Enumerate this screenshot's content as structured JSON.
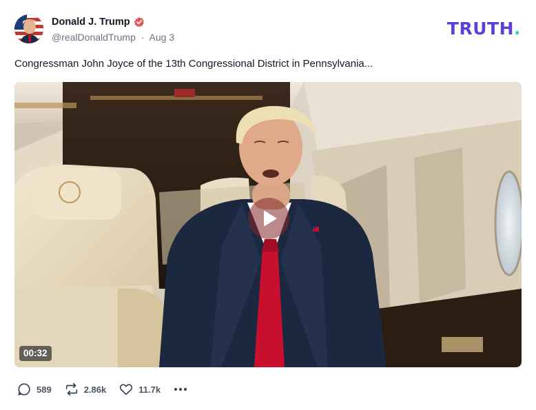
{
  "author": {
    "display_name": "Donald J. Trump",
    "handle": "@realDonaldTrump",
    "separator": "·",
    "date": "Aug 3"
  },
  "brand": {
    "logo_text": "TRUTH",
    "logo_dot": "."
  },
  "post": {
    "text": "Congressman John Joyce of the 13th Congressional District in Pennsylvania..."
  },
  "media": {
    "duration": "00:32",
    "play_icon": "play-icon"
  },
  "actions": {
    "replies": {
      "icon": "comment-icon",
      "count": "589"
    },
    "retruths": {
      "icon": "retruth-icon",
      "count": "2.86k"
    },
    "likes": {
      "icon": "heart-icon",
      "count": "11.7k"
    },
    "more": {
      "icon": "more-dots-icon"
    }
  },
  "colors": {
    "brand_purple": "#5b3fd6",
    "brand_teal": "#1fd3c4",
    "verified_red": "#e0585f",
    "tie_red": "#c8102e"
  }
}
